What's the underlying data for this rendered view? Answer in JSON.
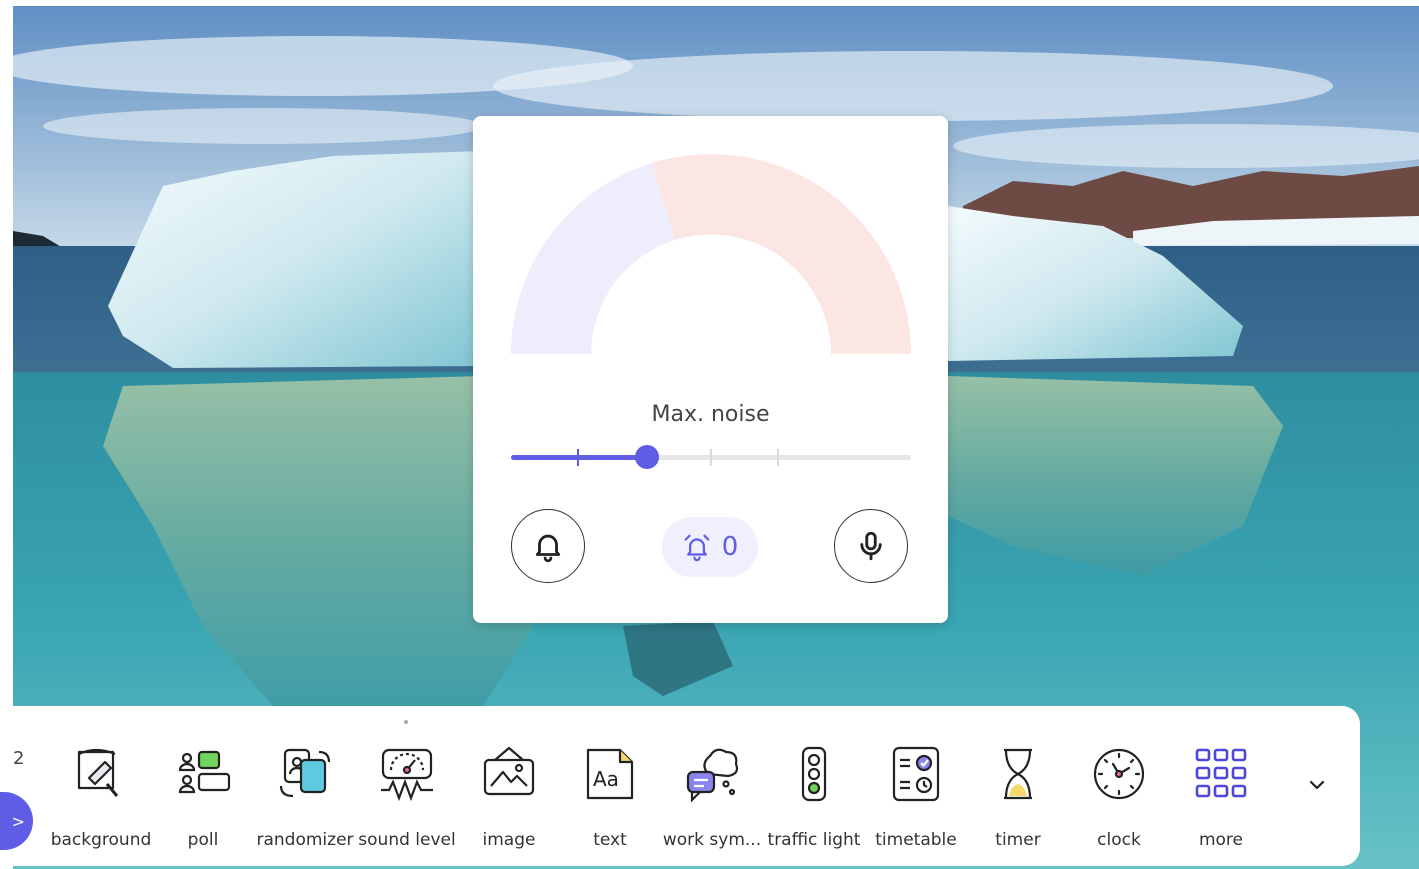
{
  "widget": {
    "label": "Max. noise",
    "level_fraction": 0.34,
    "steps": 6,
    "alarm_count": "0"
  },
  "toolbar": {
    "page_number": "2",
    "tools": [
      {
        "label": "background",
        "icon": "background-icon"
      },
      {
        "label": "poll",
        "icon": "poll-icon"
      },
      {
        "label": "randomizer",
        "icon": "randomizer-icon"
      },
      {
        "label": "sound level",
        "icon": "sound-level-icon"
      },
      {
        "label": "image",
        "icon": "image-icon"
      },
      {
        "label": "text",
        "icon": "text-icon"
      },
      {
        "label": "work sym...",
        "icon": "work-symbols-icon"
      },
      {
        "label": "traffic light",
        "icon": "traffic-light-icon"
      },
      {
        "label": "timetable",
        "icon": "timetable-icon"
      },
      {
        "label": "timer",
        "icon": "timer-icon"
      },
      {
        "label": "clock",
        "icon": "clock-icon"
      },
      {
        "label": "more",
        "icon": "more-icon"
      }
    ]
  },
  "colors": {
    "accent": "#5f5ce6",
    "gauge_quiet": "#eeedfb",
    "gauge_loud": "#fbe6e4"
  }
}
